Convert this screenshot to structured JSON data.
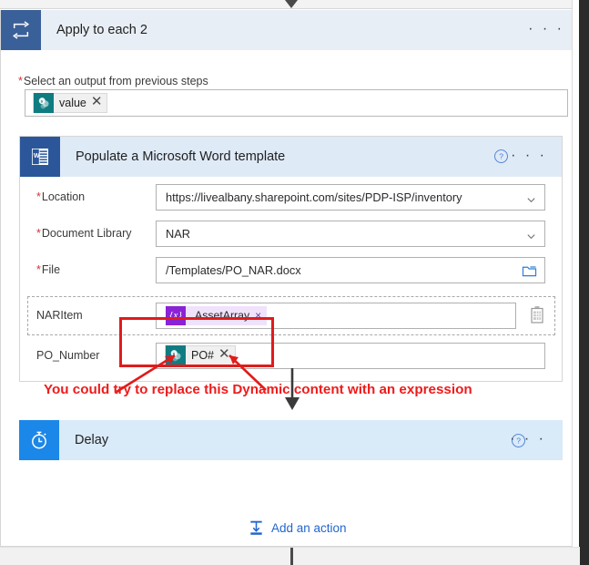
{
  "apply_card": {
    "icon": "loop-repeat-icon",
    "title": "Apply to each 2",
    "more_menu": "· · ·",
    "output_field": {
      "required_marker": "*",
      "label": "Select an output from previous steps",
      "token": {
        "icon": "sharepoint-icon",
        "text": "value",
        "remove": "✕"
      }
    }
  },
  "word_card": {
    "icon": "word-document-icon",
    "title": "Populate a Microsoft Word template",
    "help": "?",
    "more_menu": "· · ·",
    "fields": [
      {
        "required": true,
        "required_marker": "*",
        "label": "Location",
        "value": "https://livealbany.sharepoint.com/sites/PDP-ISP/inventory",
        "control": "dropdown",
        "trailing_icon": "chevron-down-icon"
      },
      {
        "required": true,
        "required_marker": "*",
        "label": "Document Library",
        "value": "NAR",
        "control": "dropdown",
        "trailing_icon": "chevron-down-icon"
      },
      {
        "required": true,
        "required_marker": "*",
        "label": "File",
        "value": "/Templates/PO_NAR.docx",
        "control": "file-picker",
        "trailing_icon": "folder-icon"
      }
    ],
    "naritem": {
      "label": "NARItem",
      "trailing_icon": "table-grid-icon",
      "token": {
        "icon": "expression-icon",
        "icon_glyph": "{x}",
        "text": "AssetArray",
        "remove": "×"
      }
    },
    "po_number": {
      "label": "PO_Number",
      "token": {
        "icon": "sharepoint-icon",
        "text": "PO#",
        "remove": "✕"
      }
    }
  },
  "annotation": {
    "text": "You could try to replace this Dynamic content with an expression",
    "color": "#ee1b1b",
    "highlight_box_color": "#e01b1b",
    "pointer_color": "#e01b1b",
    "down_arrow_color": "#3a3a3a"
  },
  "delay_card": {
    "icon": "stopwatch-icon",
    "title": "Delay",
    "help": "?",
    "more_menu": "· · ·"
  },
  "add_action": {
    "icon": "add-action-icon",
    "label": "Add an action"
  },
  "colors": {
    "apply_header_bg": "#e8eef5",
    "apply_icon_bg": "#3a6099",
    "word_header_bg": "#dfeaf7",
    "word_icon_bg": "#2b579a",
    "delay_bg": "#d9eaf9",
    "delay_icon_bg": "#1b87e8",
    "sharepoint_teal": "#0f7c82",
    "expression_purple": "#8a22d6",
    "expression_chip_bg": "#f0e2fb",
    "link_blue": "#2266cc",
    "required_red": "#d13438"
  }
}
